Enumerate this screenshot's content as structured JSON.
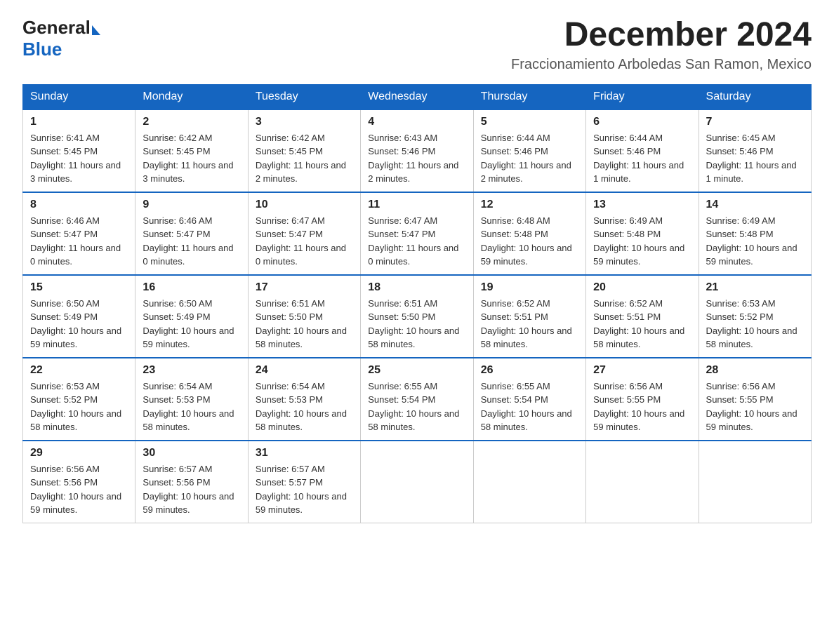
{
  "logo": {
    "text_general": "General",
    "text_blue": "Blue"
  },
  "title": "December 2024",
  "location": "Fraccionamiento Arboledas San Ramon, Mexico",
  "days_of_week": [
    "Sunday",
    "Monday",
    "Tuesday",
    "Wednesday",
    "Thursday",
    "Friday",
    "Saturday"
  ],
  "weeks": [
    [
      {
        "day": "1",
        "sunrise": "6:41 AM",
        "sunset": "5:45 PM",
        "daylight": "11 hours and 3 minutes."
      },
      {
        "day": "2",
        "sunrise": "6:42 AM",
        "sunset": "5:45 PM",
        "daylight": "11 hours and 3 minutes."
      },
      {
        "day": "3",
        "sunrise": "6:42 AM",
        "sunset": "5:45 PM",
        "daylight": "11 hours and 2 minutes."
      },
      {
        "day": "4",
        "sunrise": "6:43 AM",
        "sunset": "5:46 PM",
        "daylight": "11 hours and 2 minutes."
      },
      {
        "day": "5",
        "sunrise": "6:44 AM",
        "sunset": "5:46 PM",
        "daylight": "11 hours and 2 minutes."
      },
      {
        "day": "6",
        "sunrise": "6:44 AM",
        "sunset": "5:46 PM",
        "daylight": "11 hours and 1 minute."
      },
      {
        "day": "7",
        "sunrise": "6:45 AM",
        "sunset": "5:46 PM",
        "daylight": "11 hours and 1 minute."
      }
    ],
    [
      {
        "day": "8",
        "sunrise": "6:46 AM",
        "sunset": "5:47 PM",
        "daylight": "11 hours and 0 minutes."
      },
      {
        "day": "9",
        "sunrise": "6:46 AM",
        "sunset": "5:47 PM",
        "daylight": "11 hours and 0 minutes."
      },
      {
        "day": "10",
        "sunrise": "6:47 AM",
        "sunset": "5:47 PM",
        "daylight": "11 hours and 0 minutes."
      },
      {
        "day": "11",
        "sunrise": "6:47 AM",
        "sunset": "5:47 PM",
        "daylight": "11 hours and 0 minutes."
      },
      {
        "day": "12",
        "sunrise": "6:48 AM",
        "sunset": "5:48 PM",
        "daylight": "10 hours and 59 minutes."
      },
      {
        "day": "13",
        "sunrise": "6:49 AM",
        "sunset": "5:48 PM",
        "daylight": "10 hours and 59 minutes."
      },
      {
        "day": "14",
        "sunrise": "6:49 AM",
        "sunset": "5:48 PM",
        "daylight": "10 hours and 59 minutes."
      }
    ],
    [
      {
        "day": "15",
        "sunrise": "6:50 AM",
        "sunset": "5:49 PM",
        "daylight": "10 hours and 59 minutes."
      },
      {
        "day": "16",
        "sunrise": "6:50 AM",
        "sunset": "5:49 PM",
        "daylight": "10 hours and 59 minutes."
      },
      {
        "day": "17",
        "sunrise": "6:51 AM",
        "sunset": "5:50 PM",
        "daylight": "10 hours and 58 minutes."
      },
      {
        "day": "18",
        "sunrise": "6:51 AM",
        "sunset": "5:50 PM",
        "daylight": "10 hours and 58 minutes."
      },
      {
        "day": "19",
        "sunrise": "6:52 AM",
        "sunset": "5:51 PM",
        "daylight": "10 hours and 58 minutes."
      },
      {
        "day": "20",
        "sunrise": "6:52 AM",
        "sunset": "5:51 PM",
        "daylight": "10 hours and 58 minutes."
      },
      {
        "day": "21",
        "sunrise": "6:53 AM",
        "sunset": "5:52 PM",
        "daylight": "10 hours and 58 minutes."
      }
    ],
    [
      {
        "day": "22",
        "sunrise": "6:53 AM",
        "sunset": "5:52 PM",
        "daylight": "10 hours and 58 minutes."
      },
      {
        "day": "23",
        "sunrise": "6:54 AM",
        "sunset": "5:53 PM",
        "daylight": "10 hours and 58 minutes."
      },
      {
        "day": "24",
        "sunrise": "6:54 AM",
        "sunset": "5:53 PM",
        "daylight": "10 hours and 58 minutes."
      },
      {
        "day": "25",
        "sunrise": "6:55 AM",
        "sunset": "5:54 PM",
        "daylight": "10 hours and 58 minutes."
      },
      {
        "day": "26",
        "sunrise": "6:55 AM",
        "sunset": "5:54 PM",
        "daylight": "10 hours and 58 minutes."
      },
      {
        "day": "27",
        "sunrise": "6:56 AM",
        "sunset": "5:55 PM",
        "daylight": "10 hours and 59 minutes."
      },
      {
        "day": "28",
        "sunrise": "6:56 AM",
        "sunset": "5:55 PM",
        "daylight": "10 hours and 59 minutes."
      }
    ],
    [
      {
        "day": "29",
        "sunrise": "6:56 AM",
        "sunset": "5:56 PM",
        "daylight": "10 hours and 59 minutes."
      },
      {
        "day": "30",
        "sunrise": "6:57 AM",
        "sunset": "5:56 PM",
        "daylight": "10 hours and 59 minutes."
      },
      {
        "day": "31",
        "sunrise": "6:57 AM",
        "sunset": "5:57 PM",
        "daylight": "10 hours and 59 minutes."
      },
      null,
      null,
      null,
      null
    ]
  ]
}
